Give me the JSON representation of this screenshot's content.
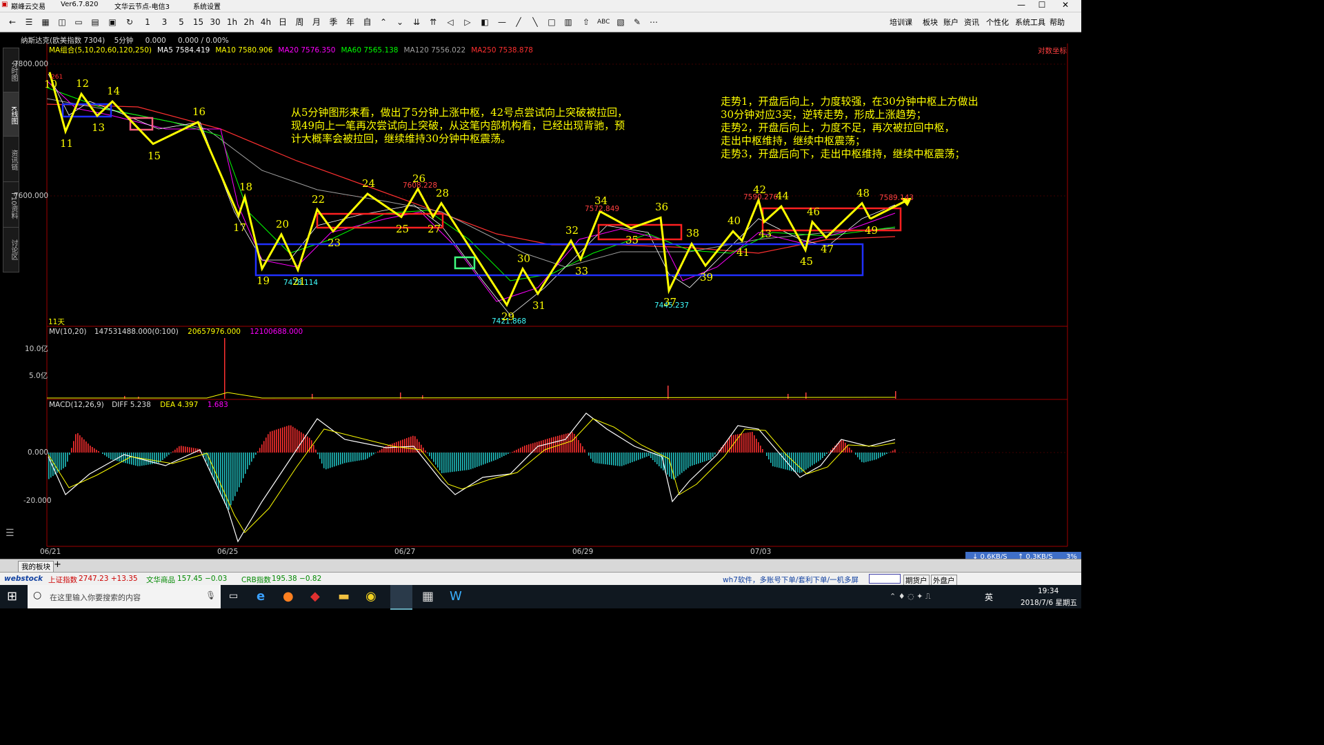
{
  "window": {
    "app_title": "巅峰云交易",
    "version": "Ver6.7.820",
    "server": "文华云节点-电信3",
    "menu_system": "系统设置",
    "min": "—",
    "max": "☐",
    "close": "✕"
  },
  "toolbar": {
    "period_buttons": [
      "1",
      "3",
      "5",
      "15",
      "30",
      "1h",
      "2h",
      "4h",
      "日",
      "周",
      "月",
      "季",
      "年",
      "自"
    ],
    "right_menu": [
      "培训课",
      "板块",
      "账户",
      "资讯",
      "个性化",
      "系统工具",
      "帮助"
    ]
  },
  "side_tabs": [
    "分时图",
    "K线图",
    "资讯链",
    "F10资料",
    "讨论区"
  ],
  "header": {
    "symbol": "纳斯达克(欧美指数 7304)",
    "period": "5分钟",
    "price": "0.000",
    "change": "0.000 / 0.00%",
    "right_label": "对数坐标"
  },
  "ma_line": {
    "label": "MA组合(5,10,20,60,120,250)",
    "items": [
      {
        "text": "MA5 7584.419",
        "color": "#ffffff"
      },
      {
        "text": "MA10 7580.906",
        "color": "#ffff00"
      },
      {
        "text": "MA20 7576.350",
        "color": "#ff00ff"
      },
      {
        "text": "MA60 7565.138",
        "color": "#00ff00"
      },
      {
        "text": "MA120 7556.022",
        "color": "#a0a0a0"
      },
      {
        "text": "MA250 7538.878",
        "color": "#ff3030"
      }
    ]
  },
  "price_axis": {
    "top": "7800.000",
    "mid": "7600.000"
  },
  "price_labels": {
    "high_left": "261",
    "p7478": "7478.114",
    "p7608": "7608.228",
    "p7421": "7421.868",
    "p7572": "7572.849",
    "p7445": "7445.237",
    "p7590": "7590.276",
    "p7589": "7589.143",
    "days": "11天"
  },
  "annotations": {
    "left": "从5分钟图形来看，做出了5分钟上涨中枢，42号点尝试向上突破被拉回，\n现49向上一笔再次尝试向上突破，从这笔内部机构看，已经出现背驰，预\n计大概率会被拉回，继续维持30分钟中枢震荡。",
    "right": "走势1，开盘后向上，力度较强，在30分钟中枢上方做出\n30分钟对应3买，逆转走势，形成上涨趋势；\n走势2，开盘后向上，力度不足，再次被拉回中枢，\n走出中枢维持，继续中枢震荡；\n走势3，开盘后向下，走出中枢维持，继续中枢震荡；"
  },
  "volume": {
    "label": "MV(10,20)",
    "v1": "147531488.000(0:100)",
    "v2": "20657976.000",
    "v3": "12100688.000",
    "axis_10": "10.0亿",
    "axis_5": "5.0亿"
  },
  "macd": {
    "label": "MACD(12,26,9)",
    "diff": "DIFF 5.238",
    "dea": "DEA 4.397",
    "macd": "1.683",
    "axis_0": "0.000",
    "axis_20": "-20.000"
  },
  "dates": [
    "06/21",
    "06/25",
    "06/27",
    "06/29",
    "07/03"
  ],
  "tabs": {
    "my_board": "我的板块",
    "add": "+"
  },
  "status": {
    "brand": "webstock",
    "idx1_name": "上证指数",
    "idx1_val": "2747.23 +13.35",
    "idx2_name": "文华商品",
    "idx2_val": "157.45 −0.03",
    "idx3_name": "CRB指数",
    "idx3_val": "195.38 −0.82",
    "promo": "wh7软件，多账号下单/套利下单/一机多屏",
    "btn1": "期货户",
    "btn2": "外盘户"
  },
  "speed": {
    "down": "↓ 0.6KB/S",
    "up": "↑ 0.3KB/S",
    "pct": "3%"
  },
  "taskbar": {
    "search_placeholder": "在这里输入你要搜索的内容",
    "ime": "英",
    "time": "19:34",
    "date": "2018/7/6 星期五"
  },
  "chart_data": {
    "type": "line",
    "note_series": "zigzag stroke points numbered 10-49 (bi endpoints), price units",
    "price_range": [
      7400,
      7810
    ],
    "zigzag": [
      {
        "n": "10",
        "p": 7795
      },
      {
        "n": "11",
        "p": 7700
      },
      {
        "n": "12",
        "p": 7760
      },
      {
        "n": "13",
        "p": 7725
      },
      {
        "n": "14",
        "p": 7748
      },
      {
        "n": "15",
        "p": 7680
      },
      {
        "n": "16",
        "p": 7715
      },
      {
        "n": "17",
        "p": 7565
      },
      {
        "n": "18",
        "p": 7595
      },
      {
        "n": "19",
        "p": 7480
      },
      {
        "n": "20",
        "p": 7535
      },
      {
        "n": "21",
        "p": 7478
      },
      {
        "n": "22",
        "p": 7575
      },
      {
        "n": "23",
        "p": 7540
      },
      {
        "n": "24",
        "p": 7600
      },
      {
        "n": "25",
        "p": 7563
      },
      {
        "n": "26",
        "p": 7608
      },
      {
        "n": "27",
        "p": 7563
      },
      {
        "n": "28",
        "p": 7585
      },
      {
        "n": "29",
        "p": 7422
      },
      {
        "n": "30",
        "p": 7480
      },
      {
        "n": "31",
        "p": 7440
      },
      {
        "n": "32",
        "p": 7525
      },
      {
        "n": "33",
        "p": 7495
      },
      {
        "n": "34",
        "p": 7572
      },
      {
        "n": "35",
        "p": 7545
      },
      {
        "n": "36",
        "p": 7562
      },
      {
        "n": "37",
        "p": 7445
      },
      {
        "n": "38",
        "p": 7520
      },
      {
        "n": "39",
        "p": 7485
      },
      {
        "n": "40",
        "p": 7540
      },
      {
        "n": "41",
        "p": 7525
      },
      {
        "n": "42",
        "p": 7590
      },
      {
        "n": "43",
        "p": 7555
      },
      {
        "n": "44",
        "p": 7580
      },
      {
        "n": "45",
        "p": 7510
      },
      {
        "n": "46",
        "p": 7555
      },
      {
        "n": "47",
        "p": 7530
      },
      {
        "n": "48",
        "p": 7585
      },
      {
        "n": "49",
        "p": 7560
      }
    ]
  }
}
